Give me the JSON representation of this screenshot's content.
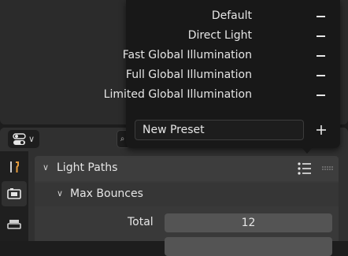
{
  "presets_popup": {
    "items": [
      {
        "label": "Default"
      },
      {
        "label": "Direct Light"
      },
      {
        "label": "Fast Global Illumination"
      },
      {
        "label": "Full Global Illumination"
      },
      {
        "label": "Limited Global Illumination"
      }
    ],
    "new_preset_value": "New Preset"
  },
  "properties": {
    "tabs": [
      {
        "icon": "wrench-screwdriver-icon",
        "active": false
      },
      {
        "icon": "render-camera-back-icon",
        "active": true
      },
      {
        "icon": "printer-output-icon",
        "active": false
      }
    ],
    "panel": {
      "title": "Light Paths",
      "subpanel": {
        "title": "Max Bounces",
        "fields": [
          {
            "label": "Total",
            "value": "12"
          }
        ]
      }
    }
  },
  "colors": {
    "popup_bg": "#181818",
    "panel_header": "#3d3d3d",
    "field_bg": "#545454",
    "text": "#e6e6e6"
  }
}
